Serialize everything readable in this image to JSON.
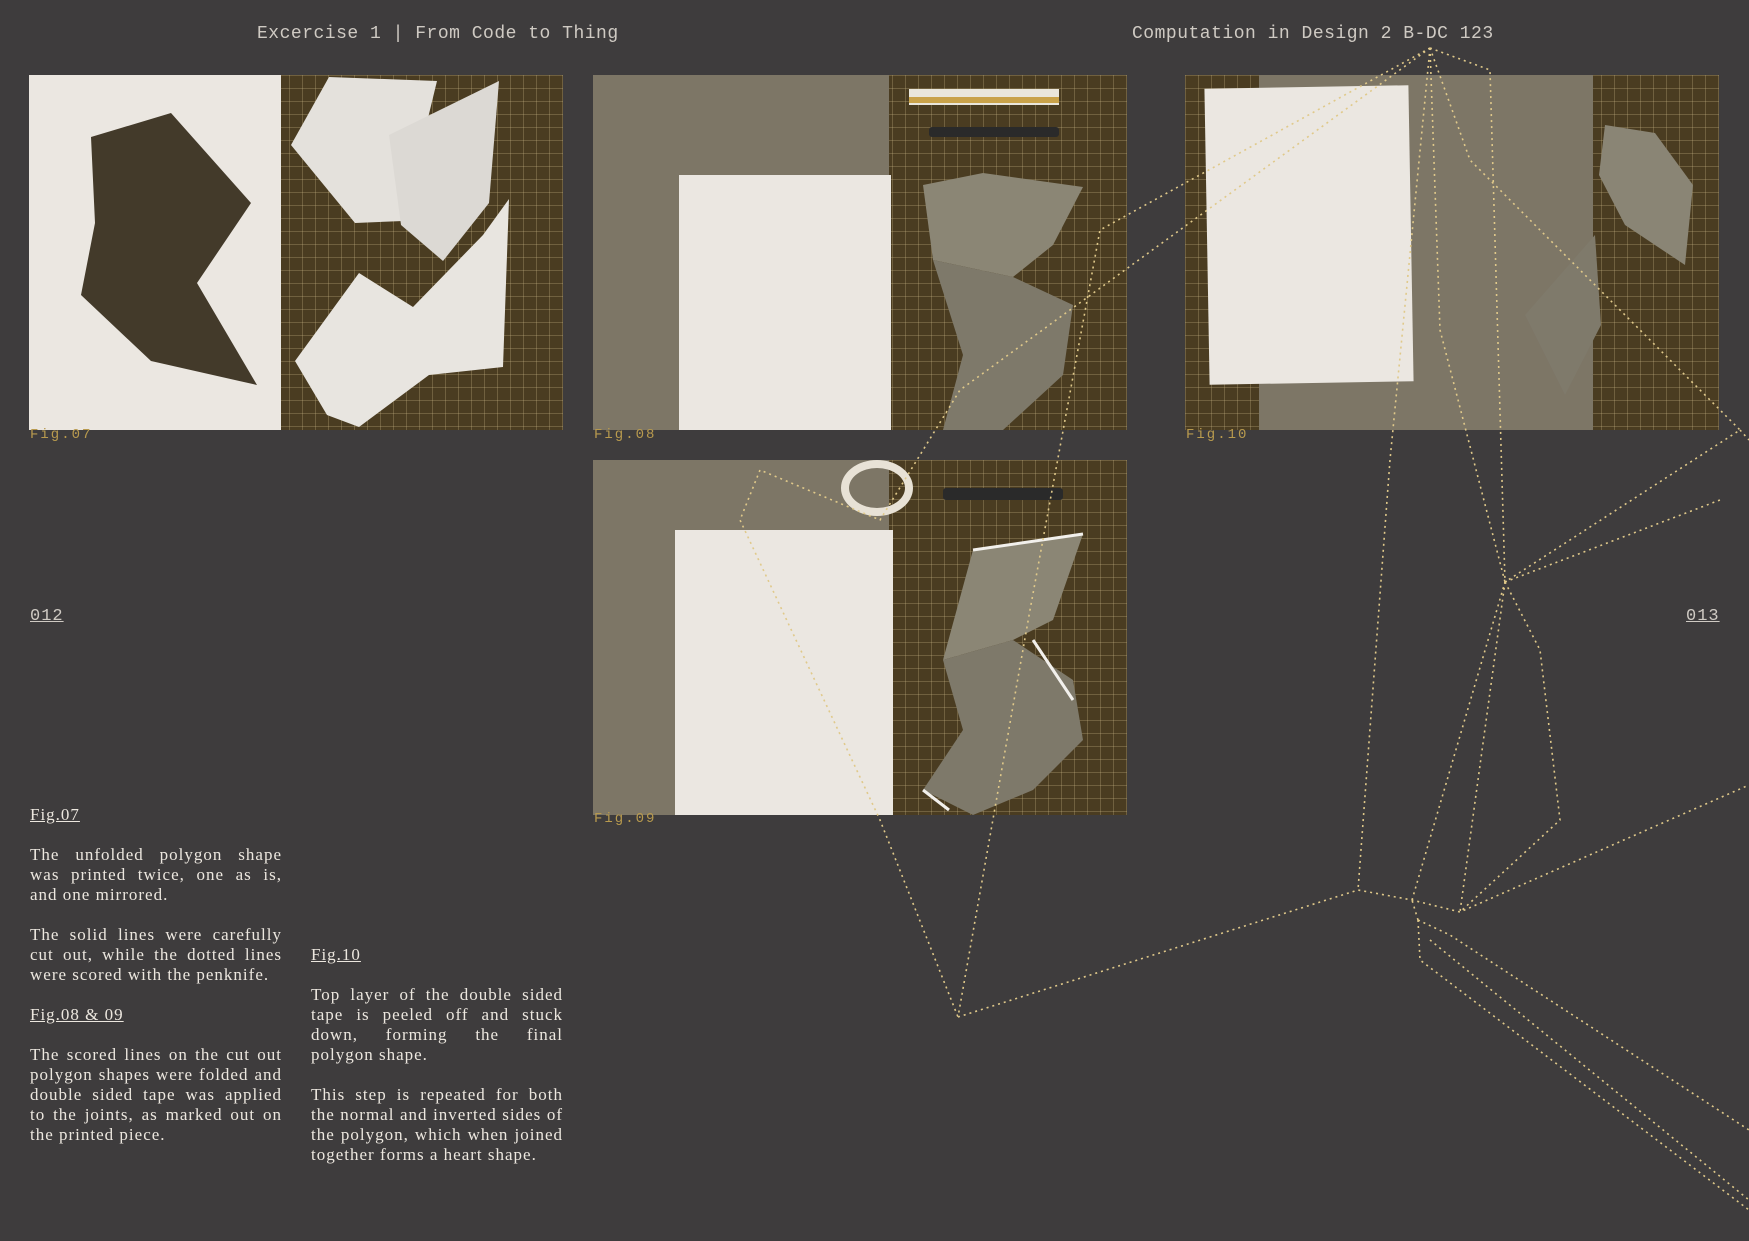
{
  "header": {
    "left": "Excercise 1 | From Code to Thing",
    "right": "Computation in Design 2 B-DC 123"
  },
  "page_numbers": {
    "left": "012",
    "right": "013"
  },
  "figures": {
    "fig07": "Fig.07",
    "fig08": "Fig.08",
    "fig09": "Fig.09",
    "fig10": "Fig.10"
  },
  "captions": {
    "col1": {
      "title1": "Fig.07",
      "p1": "The unfolded polygon shape was printed twice, one as is, and one mirrored.",
      "p2": "The solid lines were carefully cut out, while the dotted lines were scored with the penknife.",
      "title2": "Fig.08 & 09",
      "p3": "The scored lines on the cut out polygon shapes were folded and double sided tape was applied to the joints, as marked out on the printed piece."
    },
    "col2": {
      "title": "Fig.10",
      "p1": "Top layer of the double sided tape is peeled off and stuck down, forming the final polygon shape.",
      "p2": "This step is repeated for both the normal and inverted sides of the polygon, which when joined together forms a heart shape."
    }
  },
  "colors": {
    "background": "#3e3c3d",
    "accent": "#b89a4e",
    "overlay_line": "#e0c98a"
  }
}
